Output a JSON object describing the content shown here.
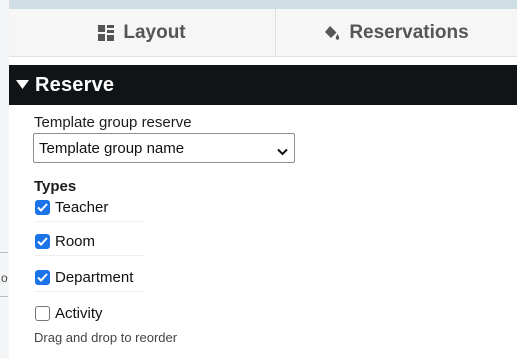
{
  "tabs": [
    {
      "label": "Layout",
      "icon": "layout-grid-icon"
    },
    {
      "label": "Reservations",
      "icon": "paint-bucket-icon"
    }
  ],
  "reserve_section": {
    "title": "Reserve",
    "expanded": true,
    "template_group": {
      "label": "Template group reserve",
      "selected": "Template group name"
    },
    "types": {
      "label": "Types",
      "items": [
        {
          "label": "Teacher",
          "checked": true
        },
        {
          "label": "Room",
          "checked": true
        },
        {
          "label": "Department",
          "checked": true
        },
        {
          "label": "Activity",
          "checked": false
        }
      ]
    },
    "hint": "Drag and drop to reorder"
  },
  "colors": {
    "header_bg": "#101417",
    "checkbox_accent": "#1a73e8"
  }
}
